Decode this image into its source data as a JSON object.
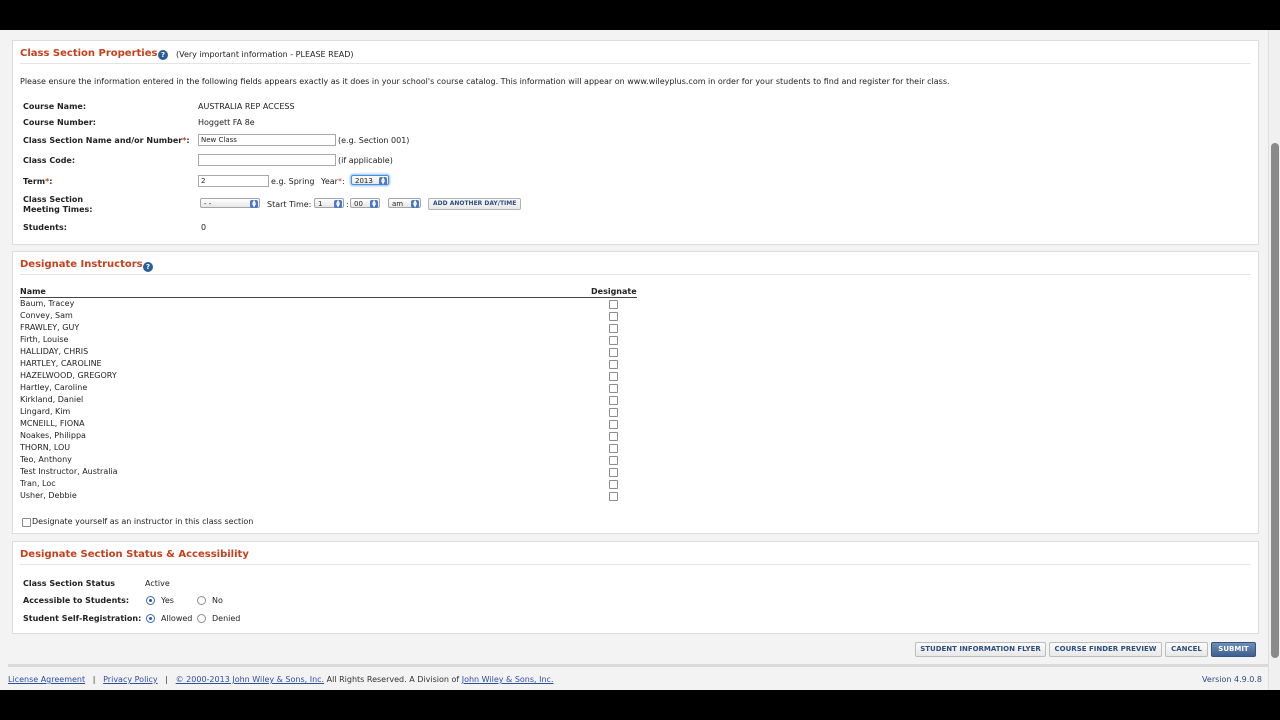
{
  "properties": {
    "title": "Class Section Properties",
    "note": "(Very important information - PLEASE READ)",
    "intro": "Please ensure the information entered in the following fields appears exactly as it does in your school's course catalog. This information will appear on www.wileyplus.com in order for your students to find and register for their class.",
    "course_name_label": "Course Name:",
    "course_name": "AUSTRALIA REP ACCESS",
    "course_number_label": "Course Number:",
    "course_number": "Hoggett FA 8e",
    "section_name_label": "Class Section Name and/or Number",
    "section_name_value": "New Class",
    "section_name_hint": "(e.g. Section 001)",
    "class_code_label": "Class Code:",
    "class_code_value": "",
    "class_code_hint": "(if applicable)",
    "term_label": "Term",
    "term_value": "2",
    "term_hint": "e.g. Spring",
    "year_label": "Year",
    "year_value": "2013",
    "meeting_label_1": "Class Section",
    "meeting_label_2": "Meeting Times:",
    "day_value": "- -",
    "start_time_label": "Start Time:",
    "hour_value": "1",
    "minute_value": "00",
    "ampm_value": "am",
    "add_day_button": "ADD ANOTHER DAY/TIME",
    "students_label": "Students:",
    "students_value": "0"
  },
  "instructors": {
    "title": "Designate Instructors",
    "col_name": "Name",
    "col_designate": "Designate",
    "rows": [
      {
        "name": "Baum, Tracey"
      },
      {
        "name": "Convey, Sam"
      },
      {
        "name": "FRAWLEY, GUY"
      },
      {
        "name": "Firth, Louise"
      },
      {
        "name": "HALLIDAY, CHRIS"
      },
      {
        "name": "HARTLEY, CAROLINE"
      },
      {
        "name": "HAZELWOOD, GREGORY"
      },
      {
        "name": "Hartley, Caroline"
      },
      {
        "name": "Kirkland, Daniel"
      },
      {
        "name": "Lingard, Kim"
      },
      {
        "name": "MCNEILL, FIONA"
      },
      {
        "name": "Noakes, Philippa"
      },
      {
        "name": "THORN, LOU"
      },
      {
        "name": "Teo, Anthony"
      },
      {
        "name": "Test Instructor, Australia"
      },
      {
        "name": "Tran, Loc"
      },
      {
        "name": "Usher, Debbie"
      }
    ],
    "self_label": "Designate yourself as an instructor in this class section"
  },
  "status": {
    "title": "Designate Section Status & Accessibility",
    "status_label": "Class Section Status",
    "status_value": "Active",
    "accessible_label": "Accessible to Students:",
    "yes_label": "Yes",
    "no_label": "No",
    "selfreg_label": "Student Self-Registration:",
    "allowed_label": "Allowed",
    "denied_label": "Denied"
  },
  "actions": {
    "flyer": "STUDENT INFORMATION FLYER",
    "preview": "COURSE FINDER PREVIEW",
    "cancel": "CANCEL",
    "submit": "SUBMIT"
  },
  "footer": {
    "license": "License Agreement",
    "sep": "|",
    "privacy": "Privacy Policy",
    "copyright_link": "© 2000-2013 John Wiley & Sons, Inc.",
    "rights": "All Rights Reserved. A Division of",
    "division_link": "John Wiley & Sons, Inc.",
    "version": "Version 4.9.0.8"
  },
  "icons": {
    "help": "question-help-icon"
  },
  "colors": {
    "section_title": "#c5401c",
    "link": "#2d4f9f",
    "primary_button": "#3e5f8f"
  }
}
